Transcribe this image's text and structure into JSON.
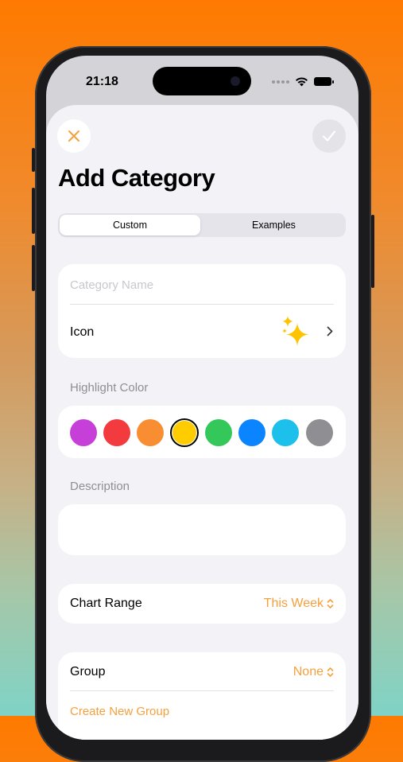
{
  "status_bar": {
    "time": "21:18"
  },
  "header": {
    "title": "Add Category"
  },
  "segmented_control": {
    "options": [
      "Custom",
      "Examples"
    ],
    "selected": "Custom"
  },
  "name_field": {
    "placeholder": "Category Name",
    "value": ""
  },
  "icon_row": {
    "label": "Icon",
    "icon": "sparkles-icon"
  },
  "highlight_color": {
    "label": "Highlight Color",
    "colors": [
      "#c63fd9",
      "#f23a3f",
      "#f98d32",
      "#ffcc00",
      "#34c759",
      "#0a84ff",
      "#1cc0ea",
      "#8e8e93"
    ],
    "selected": "#ffcc00"
  },
  "description": {
    "label": "Description",
    "value": ""
  },
  "chart_range": {
    "label": "Chart Range",
    "value": "This Week"
  },
  "group": {
    "label": "Group",
    "value": "None",
    "create_label": "Create New Group"
  },
  "theme": {
    "accent": "#f5a03c"
  }
}
